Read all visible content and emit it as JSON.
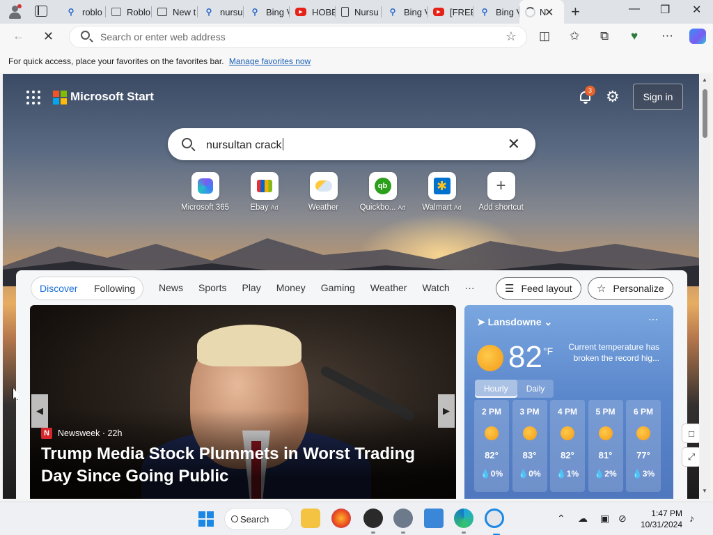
{
  "browser": {
    "tabs": [
      {
        "label": "roblo",
        "icon": "bing-icon"
      },
      {
        "label": "Roblo",
        "icon": "image-icon"
      },
      {
        "label": "New t",
        "icon": "new-tab-icon"
      },
      {
        "label": "nursu",
        "icon": "bing-icon"
      },
      {
        "label": "Bing V",
        "icon": "bing-icon"
      },
      {
        "label": "HOBB",
        "icon": "youtube-icon"
      },
      {
        "label": "Nursu",
        "icon": "document-icon"
      },
      {
        "label": "Bing V",
        "icon": "bing-icon"
      },
      {
        "label": "[FREE",
        "icon": "youtube-icon"
      },
      {
        "label": "Bing V",
        "icon": "bing-icon"
      }
    ],
    "active_tab": {
      "label": "N",
      "icon": "loading-spinner-icon"
    },
    "address_placeholder": "Search or enter web address"
  },
  "favorites_bar": {
    "message": "For quick access, place your favorites on the favorites bar.",
    "link": "Manage favorites now"
  },
  "page": {
    "brand": "Microsoft Start",
    "notification_count": "3",
    "sign_in": "Sign in",
    "search_query": "nursultan crack",
    "shortcuts": [
      {
        "label": "Microsoft 365",
        "ad": "",
        "icon": "microsoft365-icon"
      },
      {
        "label": "Ebay",
        "ad": "Ad",
        "icon": "ebay-icon"
      },
      {
        "label": "Weather",
        "ad": "",
        "icon": "weather-icon"
      },
      {
        "label": "Quickbo...",
        "ad": "Ad",
        "icon": "quickbooks-icon"
      },
      {
        "label": "Walmart",
        "ad": "Ad",
        "icon": "walmart-icon"
      },
      {
        "label": "Add shortcut",
        "ad": "",
        "icon": "plus-icon"
      }
    ],
    "feed_tabs": {
      "discover": "Discover",
      "following": "Following"
    },
    "nav": [
      "News",
      "Sports",
      "Play",
      "Money",
      "Gaming",
      "Weather",
      "Watch",
      "···"
    ],
    "feed_layout": "Feed layout",
    "personalize": "Personalize",
    "hero": {
      "source": "Newsweek",
      "age": "· 22h",
      "headline": "Trump Media Stock Plummets in Worst Trading Day Since Going Public"
    },
    "weather": {
      "location": "Lansdowne",
      "temp": "82",
      "unit": "°F",
      "note": "Current temperature has broken the record hig...",
      "tab_hourly": "Hourly",
      "tab_daily": "Daily",
      "hours": [
        {
          "time": "2 PM",
          "temp": "82°",
          "precip": "0%"
        },
        {
          "time": "3 PM",
          "temp": "83°",
          "precip": "0%"
        },
        {
          "time": "4 PM",
          "temp": "82°",
          "precip": "1%"
        },
        {
          "time": "5 PM",
          "temp": "81°",
          "precip": "2%"
        },
        {
          "time": "6 PM",
          "temp": "77°",
          "precip": "3%"
        }
      ]
    }
  },
  "taskbar": {
    "search": "Search",
    "time": "1:47 PM",
    "date": "10/31/2024"
  }
}
